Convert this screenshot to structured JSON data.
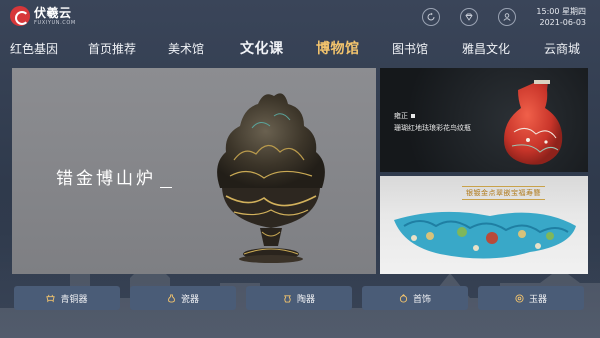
{
  "app": {
    "logo_cn": "伏羲云",
    "logo_en": "FUXIYUN.COM"
  },
  "header": {
    "time": "15:00",
    "weekday": "星期四",
    "date": "2021-06-03",
    "icons": [
      "refresh-icon",
      "diamond-icon",
      "user-icon"
    ]
  },
  "nav": {
    "items": [
      {
        "label": "红色基因"
      },
      {
        "label": "首页推荐"
      },
      {
        "label": "美术馆"
      },
      {
        "label": "文化课"
      },
      {
        "label": "博物馆"
      },
      {
        "label": "图书馆"
      },
      {
        "label": "雅昌文化"
      },
      {
        "label": "云商城"
      }
    ],
    "active_index": 4
  },
  "main": {
    "title": "错金博山炉"
  },
  "vase": {
    "era": "雍正",
    "name": "珊瑚红地珐琅彩花鸟纹瓶"
  },
  "crown": {
    "name": "银镀金点翠嵌宝福寿簪"
  },
  "categories": [
    {
      "label": "青铜器",
      "icon": "bronze-icon"
    },
    {
      "label": "瓷器",
      "icon": "porcelain-icon"
    },
    {
      "label": "陶器",
      "icon": "pottery-icon"
    },
    {
      "label": "首饰",
      "icon": "jewelry-icon"
    },
    {
      "label": "玉器",
      "icon": "jade-icon"
    }
  ],
  "colors": {
    "accent": "#f3c46d",
    "brand": "#d7373a",
    "button_bg": "#4a5c77"
  }
}
